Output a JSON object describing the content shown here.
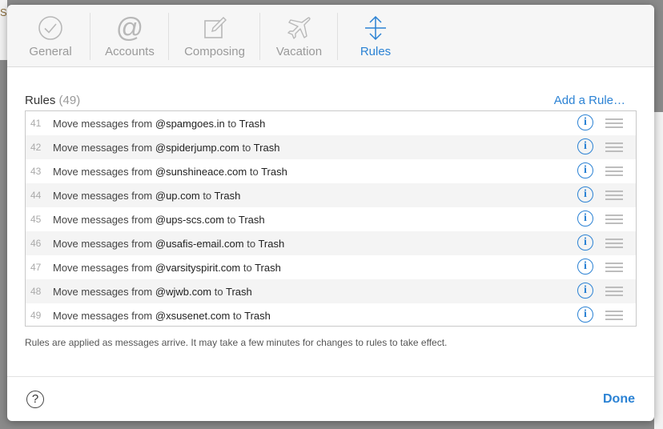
{
  "background": {
    "letter": "S"
  },
  "tabs": [
    {
      "label": "General",
      "icon": "checkmark-circle-icon"
    },
    {
      "label": "Accounts",
      "icon": "at-sign-icon"
    },
    {
      "label": "Composing",
      "icon": "compose-pencil-icon"
    },
    {
      "label": "Vacation",
      "icon": "airplane-icon"
    },
    {
      "label": "Rules",
      "icon": "arrows-move-icon",
      "active": true
    }
  ],
  "rules_section": {
    "title": "Rules",
    "count": "(49)",
    "add_label": "Add a Rule…"
  },
  "rules": [
    {
      "num": "41",
      "prefix": "Move messages from ",
      "domain": "@spamgoes.in",
      "mid": " to ",
      "dest": "Trash"
    },
    {
      "num": "42",
      "prefix": "Move messages from ",
      "domain": "@spiderjump.com",
      "mid": " to ",
      "dest": "Trash"
    },
    {
      "num": "43",
      "prefix": "Move messages from ",
      "domain": "@sunshineace.com",
      "mid": " to ",
      "dest": "Trash"
    },
    {
      "num": "44",
      "prefix": "Move messages from ",
      "domain": "@up.com",
      "mid": " to ",
      "dest": "Trash"
    },
    {
      "num": "45",
      "prefix": "Move messages from ",
      "domain": "@ups-scs.com",
      "mid": " to ",
      "dest": "Trash"
    },
    {
      "num": "46",
      "prefix": "Move messages from ",
      "domain": "@usafis-email.com",
      "mid": " to ",
      "dest": "Trash"
    },
    {
      "num": "47",
      "prefix": "Move messages from ",
      "domain": "@varsityspirit.com",
      "mid": " to ",
      "dest": "Trash"
    },
    {
      "num": "48",
      "prefix": "Move messages from ",
      "domain": "@wjwb.com",
      "mid": " to ",
      "dest": "Trash"
    },
    {
      "num": "49",
      "prefix": "Move messages from ",
      "domain": "@xsusenet.com",
      "mid": " to ",
      "dest": "Trash"
    }
  ],
  "footnote": "Rules are applied as messages arrive. It may take a few minutes for changes to rules to take effect.",
  "footer": {
    "help_label": "?",
    "done_label": "Done"
  },
  "colors": {
    "accent": "#2b82d4",
    "inactive_tab": "#9a9a9a"
  }
}
